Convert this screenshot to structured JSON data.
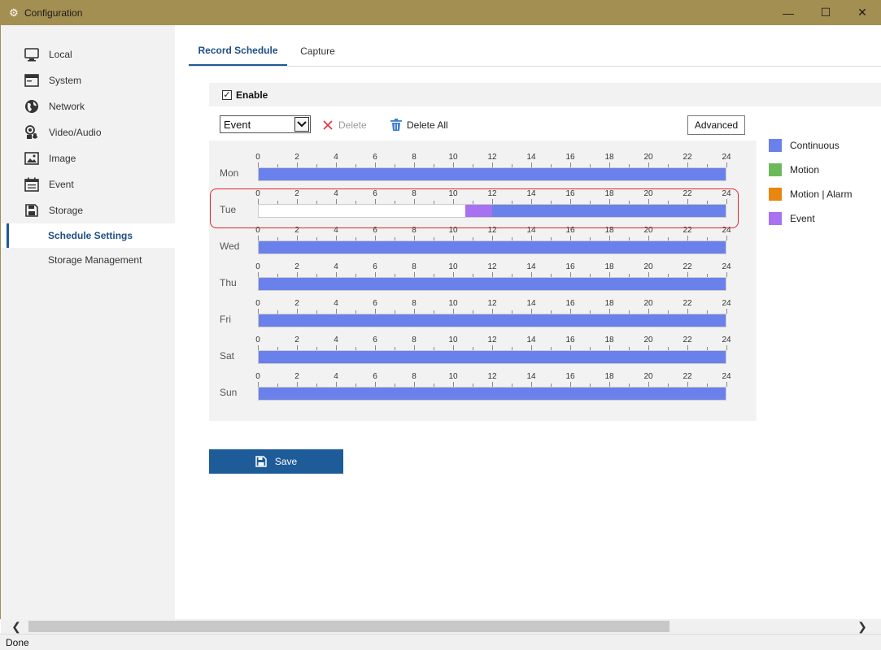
{
  "window": {
    "title": "Configuration",
    "minimize_glyph": "—",
    "maximize_glyph": "☐",
    "close_glyph": "✕"
  },
  "sidebar": {
    "items": [
      {
        "label": "Local",
        "icon": "monitor-icon"
      },
      {
        "label": "System",
        "icon": "window-icon"
      },
      {
        "label": "Network",
        "icon": "globe-icon"
      },
      {
        "label": "Video/Audio",
        "icon": "camera-mic-icon"
      },
      {
        "label": "Image",
        "icon": "image-icon"
      },
      {
        "label": "Event",
        "icon": "calendar-icon"
      },
      {
        "label": "Storage",
        "icon": "floppy-icon"
      },
      {
        "label": "Schedule Settings",
        "active": true
      },
      {
        "label": "Storage Management"
      }
    ]
  },
  "tabs": [
    {
      "label": "Record Schedule",
      "active": true
    },
    {
      "label": "Capture"
    }
  ],
  "enable": {
    "label": "Enable",
    "checked": true,
    "check_glyph": "✓"
  },
  "toolbar": {
    "record_type": {
      "selected": "Event"
    },
    "delete_label": "Delete",
    "delete_all_label": "Delete All",
    "advanced_label": "Advanced"
  },
  "schedule": {
    "hour_labels": [
      "0",
      "2",
      "4",
      "6",
      "8",
      "10",
      "12",
      "14",
      "16",
      "18",
      "20",
      "22",
      "24"
    ],
    "days": [
      {
        "label": "Mon",
        "segments": [
          {
            "start": 0,
            "end": 24,
            "type": "Continuous"
          }
        ]
      },
      {
        "label": "Tue",
        "highlighted": true,
        "segments": [
          {
            "start": 10.6,
            "end": 12,
            "type": "Event"
          },
          {
            "start": 12,
            "end": 24,
            "type": "Continuous"
          }
        ]
      },
      {
        "label": "Wed",
        "segments": [
          {
            "start": 0,
            "end": 24,
            "type": "Continuous"
          }
        ]
      },
      {
        "label": "Thu",
        "segments": [
          {
            "start": 0,
            "end": 24,
            "type": "Continuous"
          }
        ]
      },
      {
        "label": "Fri",
        "segments": [
          {
            "start": 0,
            "end": 24,
            "type": "Continuous"
          }
        ]
      },
      {
        "label": "Sat",
        "segments": [
          {
            "start": 0,
            "end": 24,
            "type": "Continuous"
          }
        ]
      },
      {
        "label": "Sun",
        "segments": [
          {
            "start": 0,
            "end": 24,
            "type": "Continuous"
          }
        ]
      }
    ]
  },
  "legend": [
    {
      "label": "Continuous",
      "color": "#6a80ea"
    },
    {
      "label": "Motion",
      "color": "#6cb95c"
    },
    {
      "label": "Motion | Alarm",
      "color": "#e8860f"
    },
    {
      "label": "Event",
      "color": "#a771f1"
    }
  ],
  "save_label": "Save",
  "status": "Done"
}
